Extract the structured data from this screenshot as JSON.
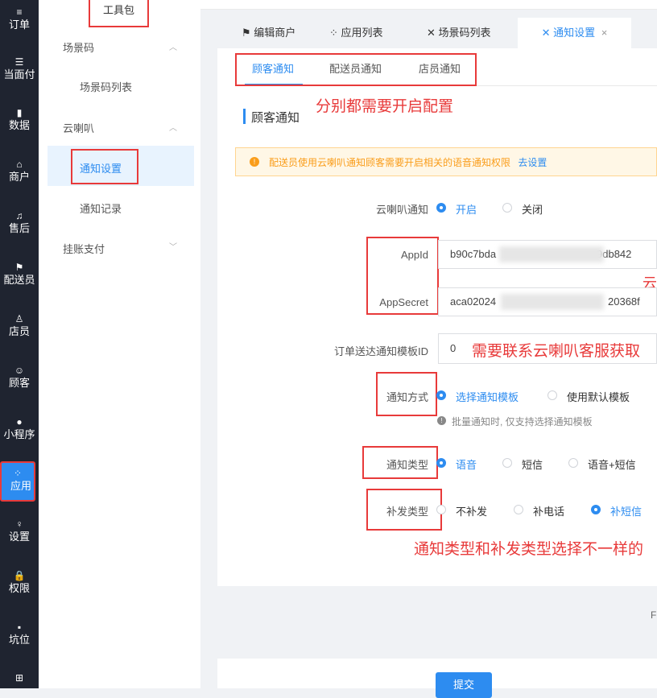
{
  "rail": [
    {
      "icon": "≡",
      "label": "订单"
    },
    {
      "icon": "☰",
      "label": "当面付"
    },
    {
      "icon": "▮",
      "label": "数据"
    },
    {
      "icon": "⌂",
      "label": "商户"
    },
    {
      "icon": "♫",
      "label": "售后"
    },
    {
      "icon": "⚑",
      "label": "配送员"
    },
    {
      "icon": "♙",
      "label": "店员"
    },
    {
      "icon": "☺",
      "label": "顾客"
    },
    {
      "icon": "●",
      "label": "小程序"
    },
    {
      "icon": "⁘",
      "label": "应用"
    },
    {
      "icon": "♀",
      "label": "设置"
    },
    {
      "icon": "🔒",
      "label": "权限"
    },
    {
      "icon": "▪",
      "label": "坑位"
    },
    {
      "icon": "⊞",
      "label": ""
    }
  ],
  "subnav": {
    "toolbox": "工具包",
    "group_scene": "场景码",
    "item_scene_list": "场景码列表",
    "group_speaker": "云喇叭",
    "item_notice_settings": "通知设置",
    "item_notice_records": "通知记录",
    "group_credit": "挂账支付"
  },
  "tabs": [
    {
      "icon": "⚑",
      "label": "编辑商户"
    },
    {
      "icon": "⁘",
      "label": "应用列表"
    },
    {
      "icon": "✕",
      "label": "场景码列表"
    },
    {
      "icon": "✕",
      "label": "通知设置",
      "close": "×"
    }
  ],
  "subtabs": [
    "顾客通知",
    "配送员通知",
    "店员通知"
  ],
  "annotations": {
    "enable_all": "分别都需要开启配置",
    "contact_service": "需要联系云喇叭客服获取",
    "cloud_partial": "云",
    "type_note": "通知类型和补发类型选择不一样的"
  },
  "section_title": "顾客通知",
  "alert": {
    "text": "配送员使用云喇叭通知顾客需要开启相关的语音通知权限",
    "link": "去设置"
  },
  "form": {
    "speaker_label": "云喇叭通知",
    "speaker_on": "开启",
    "speaker_off": "关闭",
    "appid_label": "AppId",
    "appid_prefix": "b90c7bda",
    "appid_suffix": "9db842",
    "appsecret_label": "AppSecret",
    "appsecret_prefix": "aca02024",
    "appsecret_suffix": "20368f",
    "template_label": "订单送达通知模板ID",
    "template_value": "0",
    "method_label": "通知方式",
    "method_opt1": "选择通知模板",
    "method_opt2": "使用默认模板",
    "method_hint": "批量通知时, 仅支持选择通知模板",
    "type_label": "通知类型",
    "type_opt1": "语音",
    "type_opt2": "短信",
    "type_opt3": "语音+短信",
    "resend_label": "补发类型",
    "resend_opt1": "不补发",
    "resend_opt2": "补电话",
    "resend_opt3": "补短信"
  },
  "submit": "提交",
  "pager_fragment": "F",
  "colors": {
    "primary": "#2d8cf0",
    "annotation": "#e83a3a",
    "rail": "#1f2430",
    "alert_bg": "#fff7e6"
  }
}
